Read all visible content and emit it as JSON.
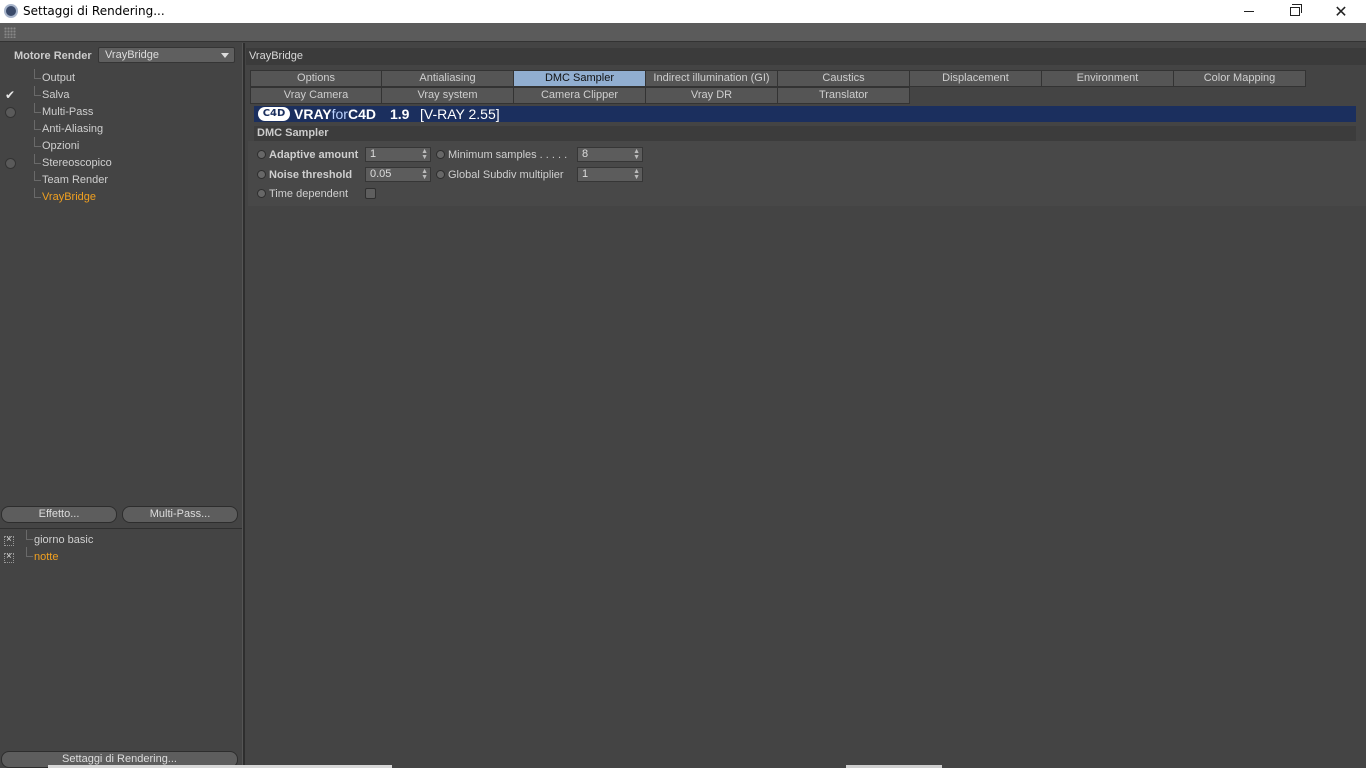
{
  "window": {
    "title": "Settaggi di Rendering...",
    "controls": [
      "minimize",
      "maximize",
      "close"
    ]
  },
  "left_panel": {
    "engine_label": "Motore Render",
    "engine_value": "VrayBridge",
    "tree": [
      {
        "label": "Output",
        "state": "none"
      },
      {
        "label": "Salva",
        "state": "checked"
      },
      {
        "label": "Multi-Pass",
        "state": "unchecked"
      },
      {
        "label": "Anti-Aliasing",
        "state": "none"
      },
      {
        "label": "Opzioni",
        "state": "none"
      },
      {
        "label": "Stereoscopico",
        "state": "unchecked"
      },
      {
        "label": "Team Render",
        "state": "none"
      },
      {
        "label": "VrayBridge",
        "state": "none",
        "active": true
      }
    ],
    "buttons": {
      "effect": "Effetto...",
      "multipass": "Multi-Pass..."
    },
    "presets": [
      {
        "label": "giorno basic",
        "active": false
      },
      {
        "label": "notte",
        "active": true
      }
    ],
    "bottom_button": "Settaggi di Rendering..."
  },
  "right_panel": {
    "header": "VrayBridge",
    "tabs_row1": [
      "Options",
      "Antialiasing",
      "DMC Sampler",
      "Indirect illumination (GI)",
      "Caustics",
      "Displacement",
      "Environment",
      "Color Mapping"
    ],
    "tabs_row2": [
      "Vray Camera",
      "Vray system",
      "Camera Clipper",
      "Vray DR",
      "Translator"
    ],
    "selected_tab": "DMC Sampler",
    "banner": {
      "logo": "C4D",
      "brand_bold": "VRAY",
      "brand_thin": "for",
      "brand_end": "C4D",
      "version": "1.9",
      "vray_version": "[V-RAY 2.55]"
    },
    "group_title": "DMC Sampler",
    "params": {
      "adaptive_amount": {
        "label": "Adaptive amount",
        "value": "1"
      },
      "noise_threshold": {
        "label": "Noise threshold",
        "value": "0.05"
      },
      "time_dependent": {
        "label": "Time dependent"
      },
      "min_samples": {
        "label": "Minimum samples . . . . .",
        "value": "8"
      },
      "global_subdiv": {
        "label": "Global Subdiv multiplier",
        "value": "1"
      }
    }
  },
  "colors": {
    "background": "#444444",
    "accent_active": "#f0a020",
    "tab_selected": "#91aed0",
    "banner": "#1b2f5e"
  }
}
